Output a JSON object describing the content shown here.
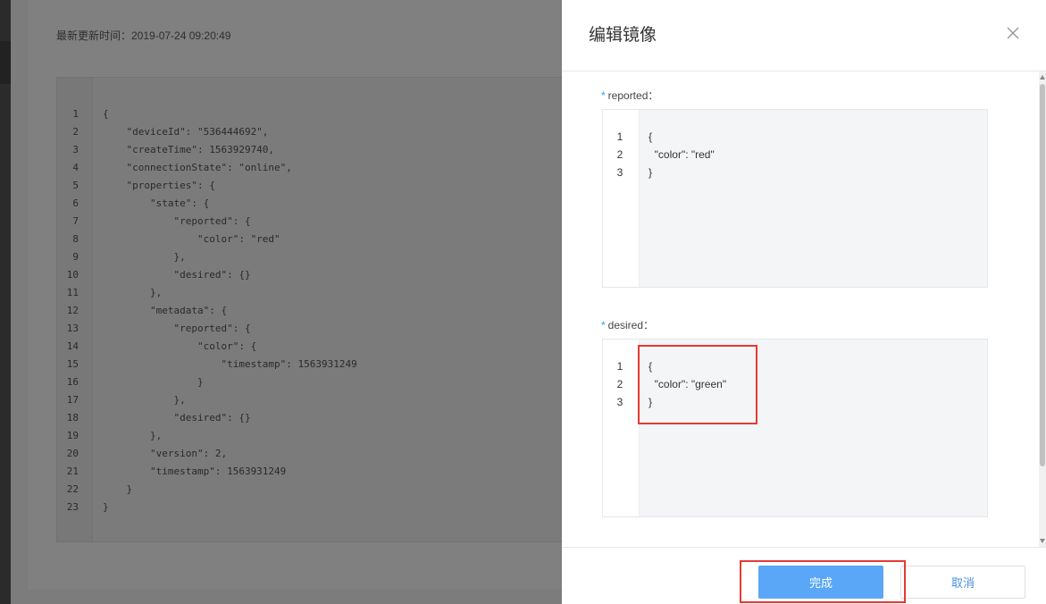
{
  "background": {
    "updated_label": "最新更新时间：2019-07-24 09:20:49",
    "code_lines": [
      "{",
      "    \"deviceId\": \"536444692\",",
      "    \"createTime\": 1563929740,",
      "    \"connectionState\": \"online\",",
      "    \"properties\": {",
      "        \"state\": {",
      "            \"reported\": {",
      "                \"color\": \"red\"",
      "            },",
      "            \"desired\": {}",
      "        },",
      "        \"metadata\": {",
      "            \"reported\": {",
      "                \"color\": {",
      "                    \"timestamp\": 1563931249",
      "                }",
      "            },",
      "            \"desired\": {}",
      "        },",
      "        \"version\": 2,",
      "        \"timestamp\": 1563931249",
      "    }",
      "}"
    ],
    "line_numbers": [
      "1",
      "2",
      "3",
      "4",
      "5",
      "6",
      "7",
      "8",
      "9",
      "10",
      "11",
      "12",
      "13",
      "14",
      "15",
      "16",
      "17",
      "18",
      "19",
      "20",
      "21",
      "22",
      "23"
    ]
  },
  "drawer": {
    "title": "编辑镜像",
    "reported": {
      "label": "reported：",
      "required_mark": "*",
      "line_numbers": [
        "1",
        "2",
        "3"
      ],
      "lines": [
        "{",
        "  \"color\": \"red\"",
        "}"
      ]
    },
    "desired": {
      "label": "desired：",
      "required_mark": "*",
      "line_numbers": [
        "1",
        "2",
        "3"
      ],
      "lines": [
        "{",
        "  \"color\": \"green\"",
        "}"
      ]
    },
    "footer": {
      "confirm_label": "完成",
      "cancel_label": "取消"
    }
  },
  "colors": {
    "accent": "#5aa7f7",
    "required": "#2aa3e6",
    "highlight": "#e53935"
  }
}
